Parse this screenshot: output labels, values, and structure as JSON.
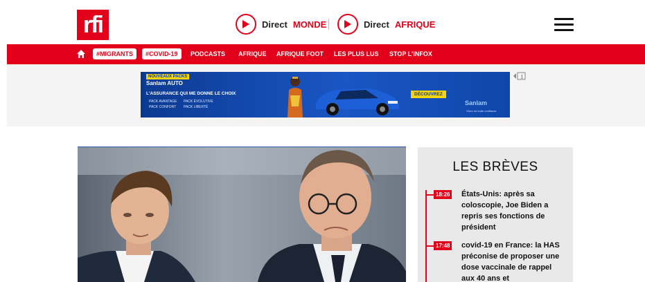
{
  "header": {
    "logo": "rfi",
    "direct_monde": {
      "label": "Direct",
      "accent": "MONDE"
    },
    "direct_afrique": {
      "label": "Direct",
      "accent": "AFRIQUE"
    }
  },
  "nav": {
    "tags": [
      "#MIGRANTS",
      "#COVID-19"
    ],
    "items": [
      "PODCASTS",
      "AFRIQUE",
      "AFRIQUE FOOT",
      "LES PLUS LUS",
      "STOP L'INFOX"
    ]
  },
  "ad": {
    "badge": "NOUVEAUX PACKS",
    "title": "Sanlam AUTO",
    "slogan": "L'ASSURANCE QUI ME DONNE LE CHOIX",
    "packs": [
      "PACK AVANTAGE",
      "PACK ÉVOLUTIVE",
      "PACK CONFORT",
      "PACK LIBERTÉ"
    ],
    "cta": "DÉCOUVREZ",
    "brand": "Sanlam",
    "brand_sub": "Vivez en toute confiance",
    "info_label": "i"
  },
  "breves": {
    "title": "LES BRÈVES",
    "items": [
      {
        "time": "18:26",
        "text": "États-Unis: après sa coloscopie, Joe Biden a repris ses fonctions de président"
      },
      {
        "time": "17:48",
        "text": "covid-19 en France: la HAS préconise de proposer une dose vaccinale de rappel aux 40 ans et"
      }
    ]
  },
  "colors": {
    "brand_red": "#e2001a",
    "ad_blue": "#0b3a91",
    "ad_yellow": "#f6d40a"
  },
  "icons": [
    "rfi-logo",
    "play-icon",
    "menu-icon",
    "home-icon",
    "ad-info-icon"
  ]
}
